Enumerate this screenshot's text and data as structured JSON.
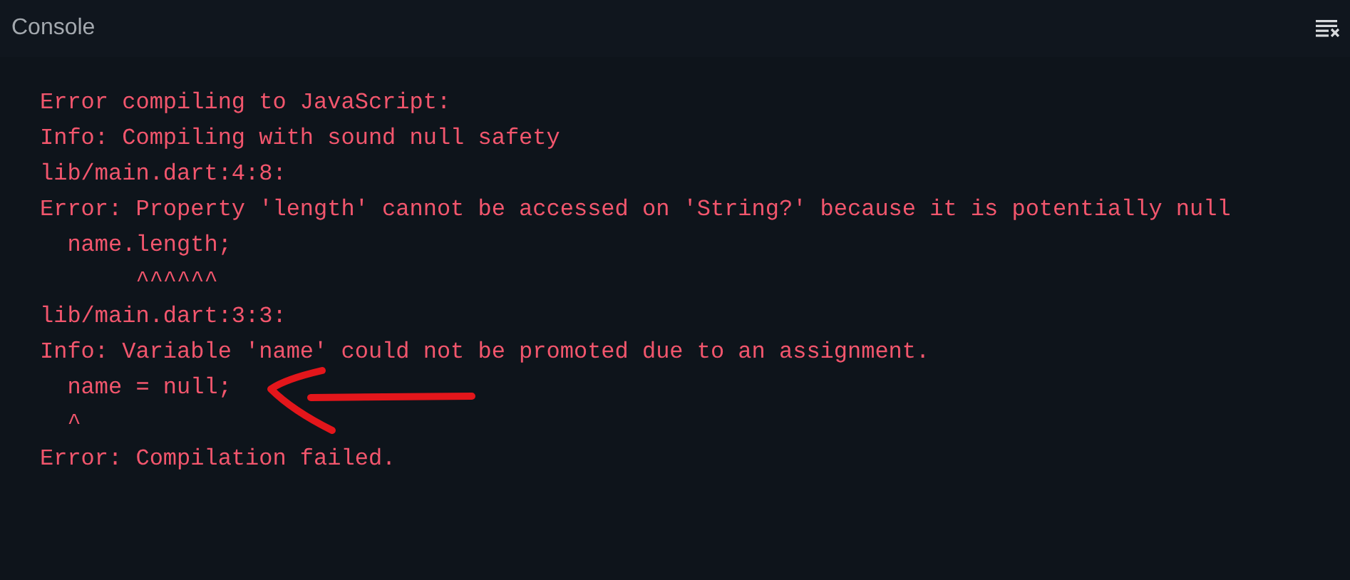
{
  "panel": {
    "title": "Console",
    "clear_button": {
      "kind": "clear"
    }
  },
  "output": {
    "lines": [
      "Error compiling to JavaScript:",
      "Info: Compiling with sound null safety",
      "lib/main.dart:4:8:",
      "Error: Property 'length' cannot be accessed on 'String?' because it is potentially null",
      "  name.length;",
      "       ^^^^^^",
      "lib/main.dart:3:3:",
      "Info: Variable 'name' could not be promoted due to an assignment.",
      "  name = null;",
      "  ^",
      "Error: Compilation failed."
    ]
  },
  "annotations": [
    {
      "kind": "arrow"
    }
  ]
}
